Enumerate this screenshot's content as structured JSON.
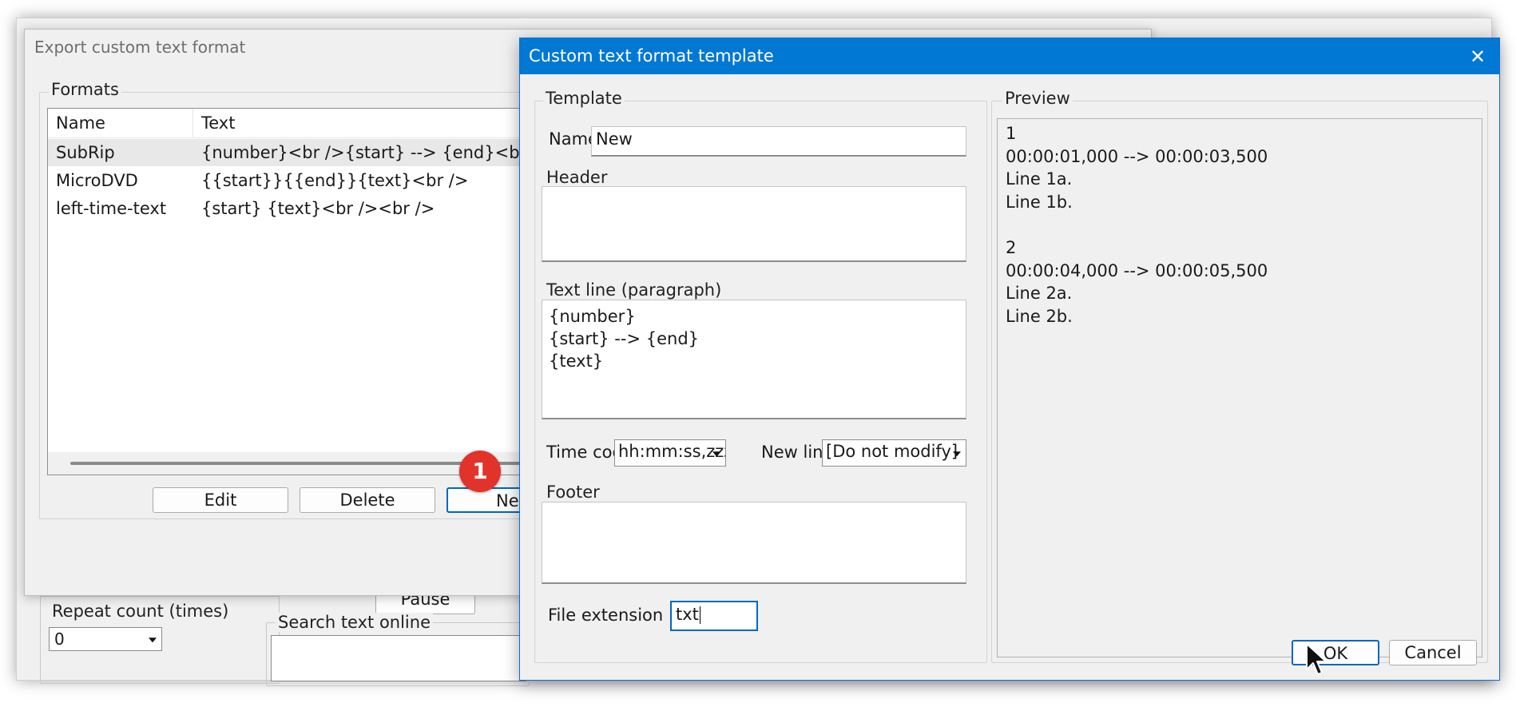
{
  "background_app": {
    "repeat_count_label": "Repeat count (times)",
    "repeat_count_value": "0",
    "pause_button": "Pause",
    "search_text_online_label": "Search text online"
  },
  "export_window": {
    "title": "Export custom text format",
    "formats_group_label": "Formats",
    "list_columns": [
      "Name",
      "Text"
    ],
    "formats": [
      {
        "name": "SubRip",
        "text": "{number}<br />{start} --> {end}<br />{text}<br /><br />"
      },
      {
        "name": "MicroDVD",
        "text": "{{start}}{{end}}{text}<br />"
      },
      {
        "name": "left-time-text",
        "text": "{start} {text}<br /><br />"
      }
    ],
    "selected_index": 0,
    "buttons": {
      "edit": "Edit",
      "delete": "Delete",
      "new": "New"
    }
  },
  "step_badge": "1",
  "template_dialog": {
    "title": "Custom text format template",
    "close_glyph": "✕",
    "template_group_label": "Template",
    "name_label": "Name",
    "name_value": "New",
    "header_label": "Header",
    "header_value": "",
    "text_line_label": "Text line (paragraph)",
    "text_line_value": "{number}\n{start} --> {end}\n{text}",
    "time_code_label": "Time code",
    "time_code_value": "hh:mm:ss,zzz",
    "new_line_label": "New line",
    "new_line_value": "[Do not modify]",
    "footer_label": "Footer",
    "footer_value": "",
    "file_extension_label": "File extension",
    "file_extension_value": "txt",
    "preview_group_label": "Preview",
    "preview_text": "1\n00:00:01,000 --> 00:00:03,500\nLine 1a.\nLine 1b.\n\n2\n00:00:04,000 --> 00:00:05,500\nLine 2a.\nLine 2b.",
    "ok_button": "OK",
    "cancel_button": "Cancel"
  },
  "colors": {
    "titlebar": "#0078d4",
    "focus": "#0067c0",
    "badge": "#e2332a",
    "dialog_bg": "#f0f0f0"
  },
  "icons": {
    "close": "close-icon",
    "dropdown": "chevron-down-icon",
    "cursor": "mouse-pointer-icon"
  }
}
